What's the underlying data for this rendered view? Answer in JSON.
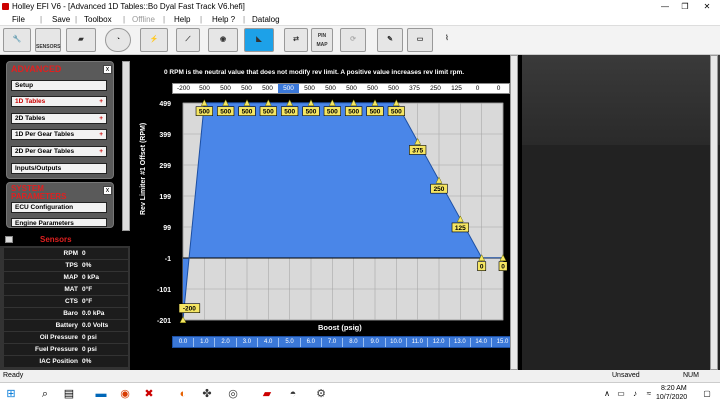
{
  "titlebar": {
    "title": "Holley EFI V6 - [Advanced 1D Tables::Bo Dyal Fast Track V6.hefi]",
    "min": "—",
    "max": "❐",
    "close": "✕"
  },
  "menu": {
    "file": "File",
    "save": "Save",
    "toolbox": "Toolbox",
    "offline": "Offline",
    "help": "Help",
    "help_q": "Help ?",
    "datalog": "Datalog"
  },
  "toolbar": {
    "sensor_label": "SENSORS",
    "pinmap_label": "PIN MAP"
  },
  "advanced": {
    "title": "ADVANCED",
    "items": [
      {
        "label": "Setup",
        "plus": ""
      },
      {
        "label": "1D Tables",
        "plus": "+"
      },
      {
        "label": "2D Tables",
        "plus": "+"
      },
      {
        "label": "1D Per Gear Tables",
        "plus": "+"
      },
      {
        "label": "2D Per Gear Tables",
        "plus": "+"
      },
      {
        "label": "Inputs/Outputs",
        "plus": ""
      }
    ]
  },
  "system": {
    "title": "SYSTEM PARAMETERS",
    "items": [
      {
        "label": "ECU Configuration"
      },
      {
        "label": "Engine Parameters"
      }
    ]
  },
  "sensors": {
    "title": "Sensors",
    "rows": [
      {
        "label": "RPM",
        "value": "0"
      },
      {
        "label": "TPS",
        "value": "0%"
      },
      {
        "label": "MAP",
        "value": "0 kPa"
      },
      {
        "label": "MAT",
        "value": "0°F"
      },
      {
        "label": "CTS",
        "value": "0°F"
      },
      {
        "label": "Baro",
        "value": "0.0 kPa"
      },
      {
        "label": "Battery",
        "value": "0.0 Volts"
      },
      {
        "label": "Oil Pressure",
        "value": "0 psi"
      },
      {
        "label": "Fuel Pressure",
        "value": "0 psi"
      },
      {
        "label": "IAC Position",
        "value": "0%"
      }
    ]
  },
  "main": {
    "info": "0 RPM  is the neutral value that does not modify rev limit.  A positive value increases rev limit rpm.",
    "values": [
      "-200",
      "500",
      "500",
      "500",
      "500",
      "500",
      "500",
      "500",
      "500",
      "500",
      "500",
      "375",
      "250",
      "125",
      "0",
      "0"
    ],
    "selected_index": 5
  },
  "chart_data": {
    "type": "area",
    "xlabel": "Boost (psig)",
    "ylabel": "Rev Limiter #1 Offset (RPM)",
    "x": [
      0.0,
      1.0,
      2.0,
      3.0,
      4.0,
      5.0,
      6.0,
      7.0,
      8.0,
      9.0,
      10.0,
      11.0,
      12.0,
      13.0,
      14.0,
      15.0
    ],
    "x_tick_labels": [
      "0.0",
      "1.0",
      "2.0",
      "3.0",
      "4.0",
      "5.0",
      "6.0",
      "7.0",
      "8.0",
      "9.0",
      "10.0",
      "11.0",
      "12.0",
      "13.0",
      "14.0",
      "15.0"
    ],
    "y": [
      -200,
      500,
      500,
      500,
      500,
      500,
      500,
      500,
      500,
      500,
      500,
      375,
      250,
      125,
      0,
      0
    ],
    "point_labels": [
      "-200",
      "500",
      "500",
      "500",
      "500",
      "500",
      "500",
      "500",
      "500",
      "500",
      "500",
      "375",
      "250",
      "125",
      "0",
      "0"
    ],
    "y_ticks": [
      499,
      399,
      299,
      199,
      99,
      -1,
      -101,
      -201
    ],
    "ylim": [
      -201,
      499
    ],
    "xlim": [
      0,
      15
    ],
    "grid": true,
    "fill_color": "#4a86e8",
    "line_color": "#000000"
  },
  "status": {
    "left": "Ready",
    "unsaved": "Unsaved",
    "num": "NUM"
  },
  "taskbar": {
    "time": "8:20 AM",
    "date": "10/7/2020"
  }
}
